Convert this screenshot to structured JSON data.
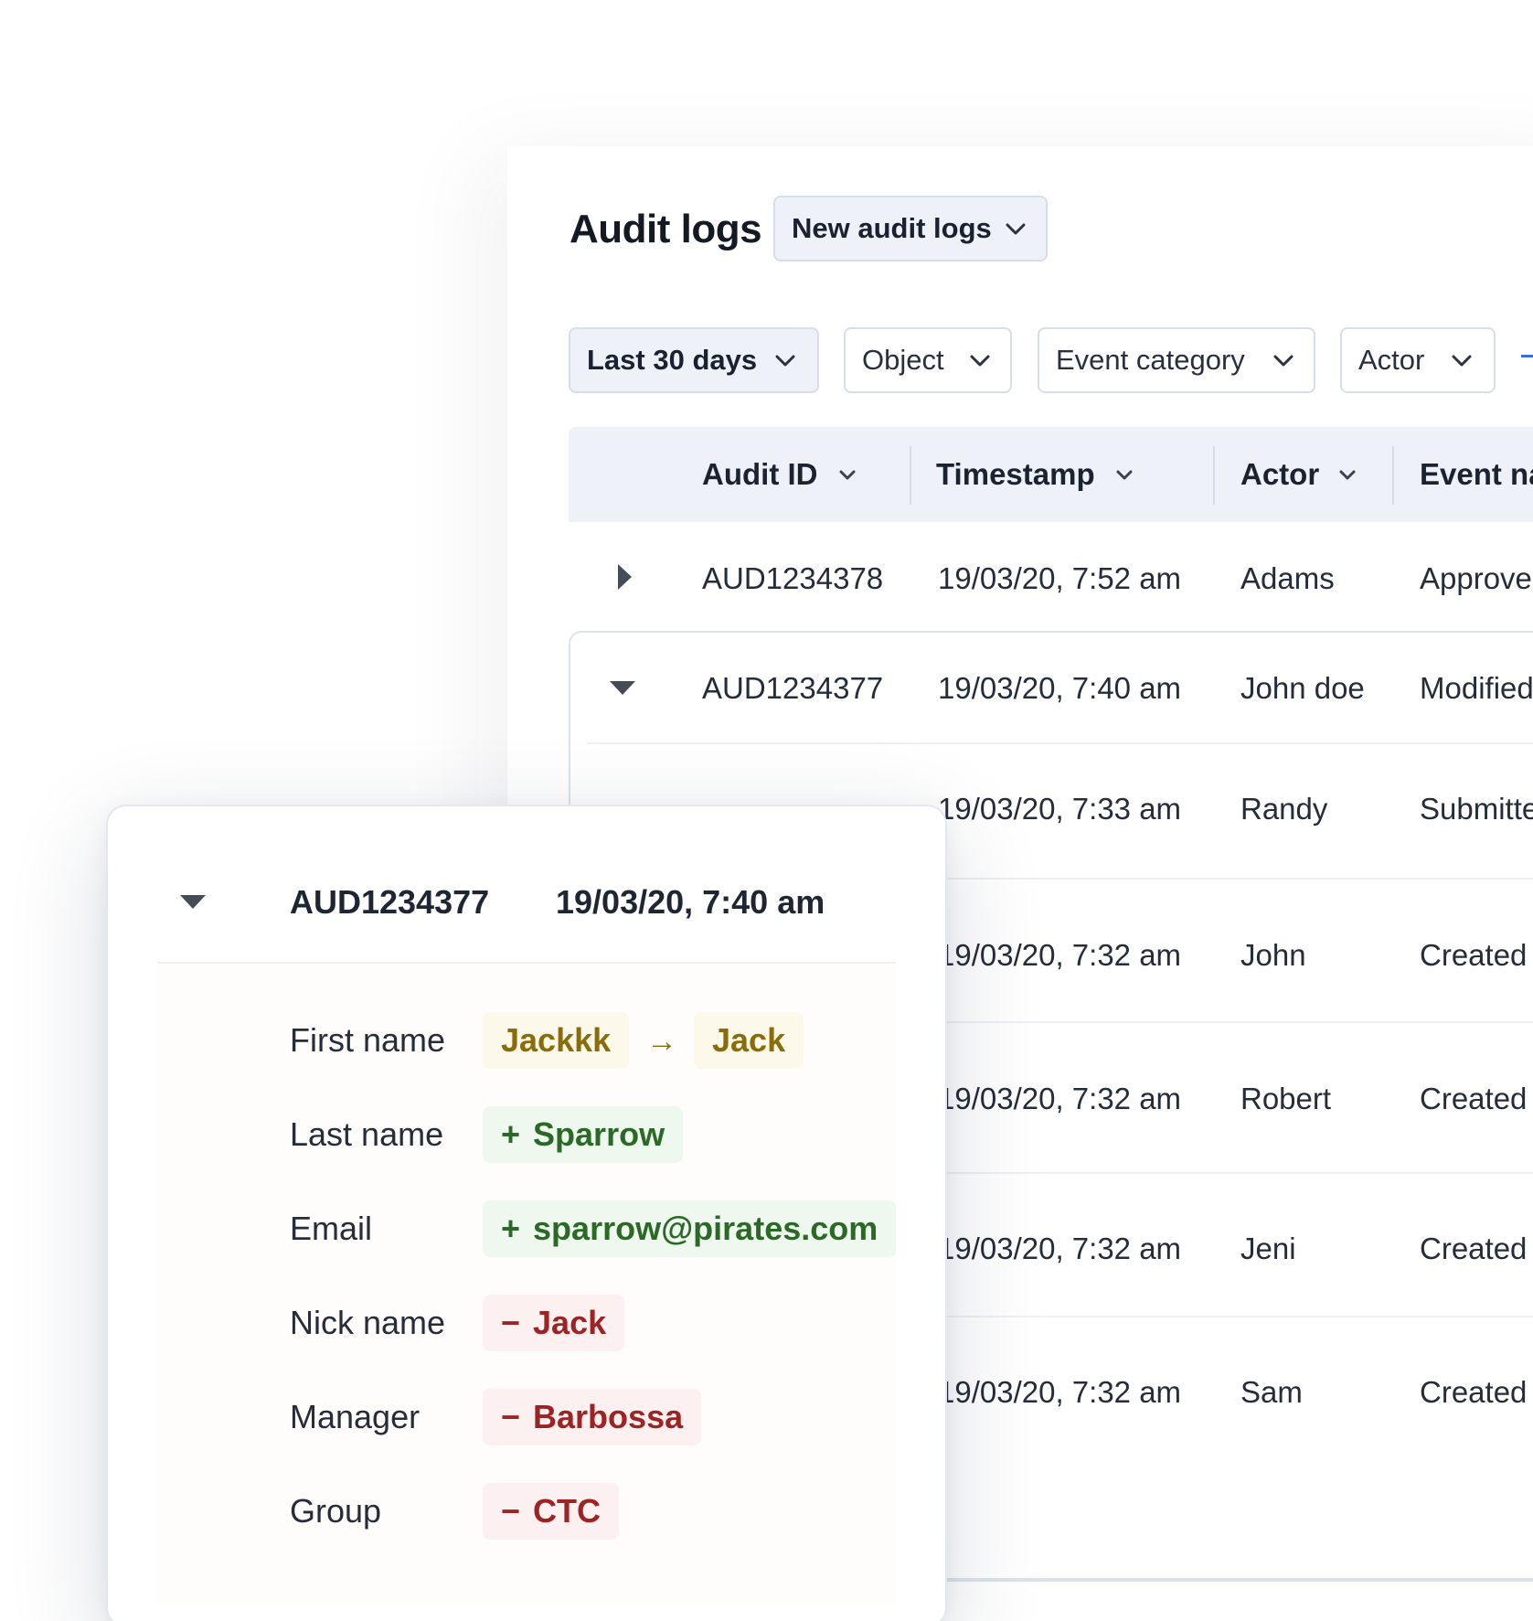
{
  "header": {
    "title": "Audit logs",
    "view_selector": "New audit logs"
  },
  "filters": [
    {
      "label": "Last 30 days",
      "active": true
    },
    {
      "label": "Object",
      "active": false
    },
    {
      "label": "Event category",
      "active": false
    },
    {
      "label": "Actor",
      "active": false
    }
  ],
  "table": {
    "columns": [
      "Audit ID",
      "Timestamp",
      "Actor",
      "Event na"
    ],
    "rows": [
      {
        "audit_id": "AUD1234378",
        "timestamp": "19/03/20, 7:52 am",
        "actor": "Adams",
        "event": "Approve",
        "expanded": false
      },
      {
        "audit_id": "AUD1234377",
        "timestamp": "19/03/20, 7:40 am",
        "actor": "John doe",
        "event": "Modified",
        "expanded": true
      },
      {
        "audit_id": "",
        "timestamp": "19/03/20, 7:33 am",
        "actor": "Randy",
        "event": "Submitte",
        "expanded": false
      },
      {
        "audit_id": "",
        "timestamp": "19/03/20, 7:32 am",
        "actor": "John",
        "event": "Created",
        "expanded": false
      },
      {
        "audit_id": "",
        "timestamp": "19/03/20, 7:32 am",
        "actor": "Robert",
        "event": "Created",
        "expanded": false
      },
      {
        "audit_id": "",
        "timestamp": "19/03/20, 7:32 am",
        "actor": "Jeni",
        "event": "Created",
        "expanded": false
      },
      {
        "audit_id": "",
        "timestamp": "19/03/20, 7:32 am",
        "actor": "Sam",
        "event": "Created",
        "expanded": false
      }
    ]
  },
  "detail_card": {
    "audit_id": "AUD1234377",
    "timestamp": "19/03/20, 7:40 am",
    "fields": [
      {
        "label": "First name",
        "change": "modified",
        "old": "Jackkk",
        "new": "Jack"
      },
      {
        "label": "Last name",
        "change": "added",
        "value": "Sparrow"
      },
      {
        "label": "Email",
        "change": "added",
        "value": "sparrow@pirates.com"
      },
      {
        "label": "Nick name",
        "change": "removed",
        "value": "Jack"
      },
      {
        "label": "Manager",
        "change": "removed",
        "value": "Barbossa"
      },
      {
        "label": "Group",
        "change": "removed",
        "value": "CTC"
      }
    ],
    "symbols": {
      "added": "+",
      "removed": "−",
      "arrow": "→"
    }
  },
  "colors": {
    "header_bg": "#eef2f8",
    "modified_text": "#8a6d0a",
    "added_text": "#2b6a26",
    "removed_text": "#9c2424",
    "accent": "#3a70d0"
  }
}
